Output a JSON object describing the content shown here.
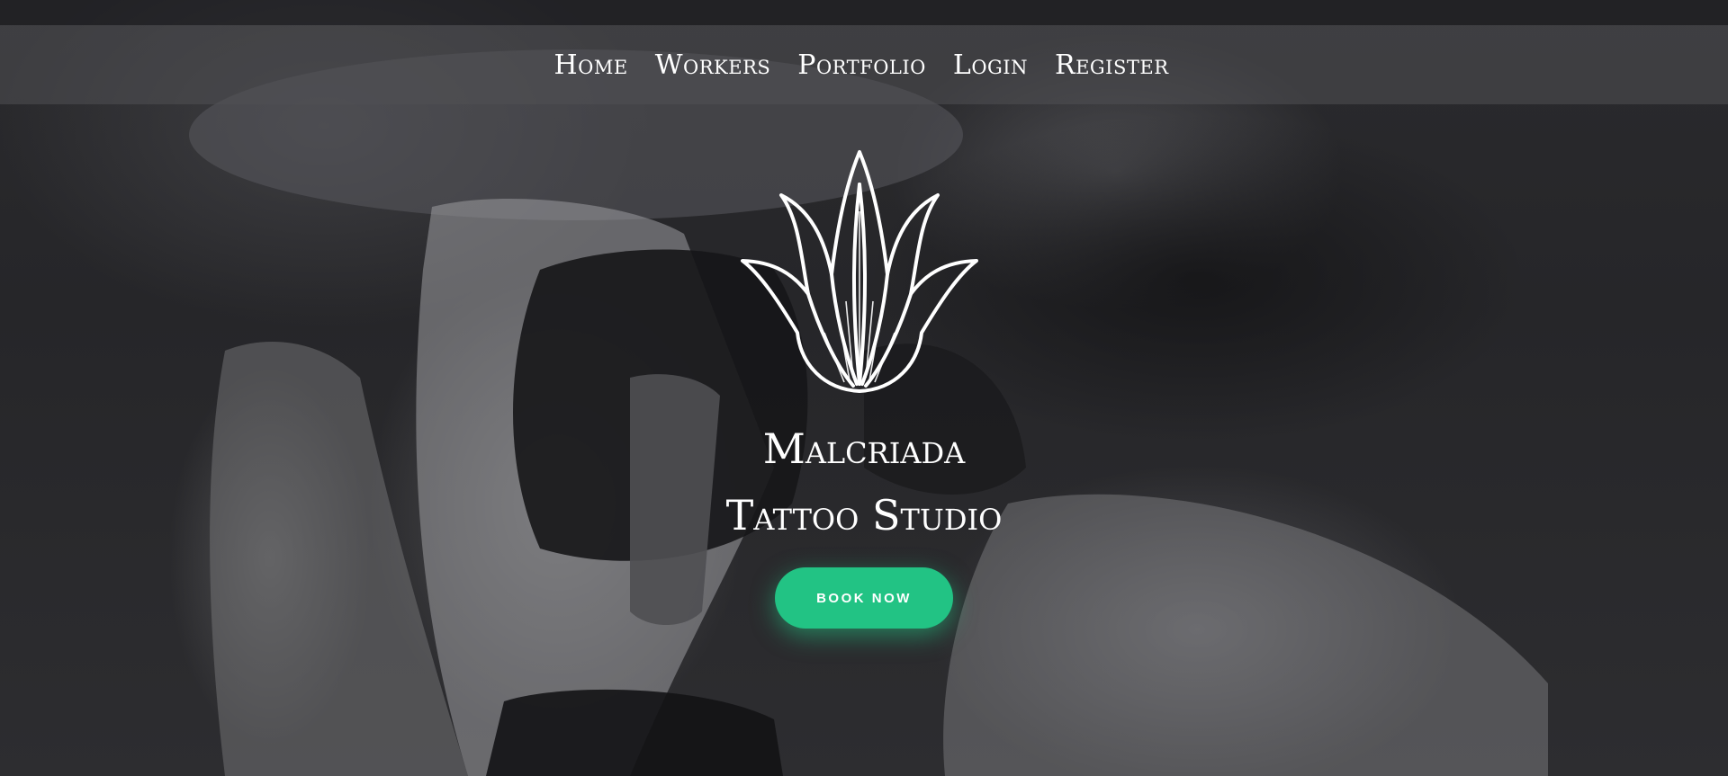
{
  "nav": {
    "items": [
      {
        "label": "Home"
      },
      {
        "label": "Workers"
      },
      {
        "label": "Portfolio"
      },
      {
        "label": "Login"
      },
      {
        "label": "Register"
      }
    ]
  },
  "hero": {
    "background": "black-and-white tattoo session photo",
    "logo_icon": "agave-plant-icon",
    "title_line1": "Malcriada",
    "title_line2": "Tattoo Studio",
    "cta_label": "BOOK NOW"
  },
  "colors": {
    "accent": "#22c384",
    "nav_text": "#ffffff",
    "background": "#2a2a2d"
  }
}
